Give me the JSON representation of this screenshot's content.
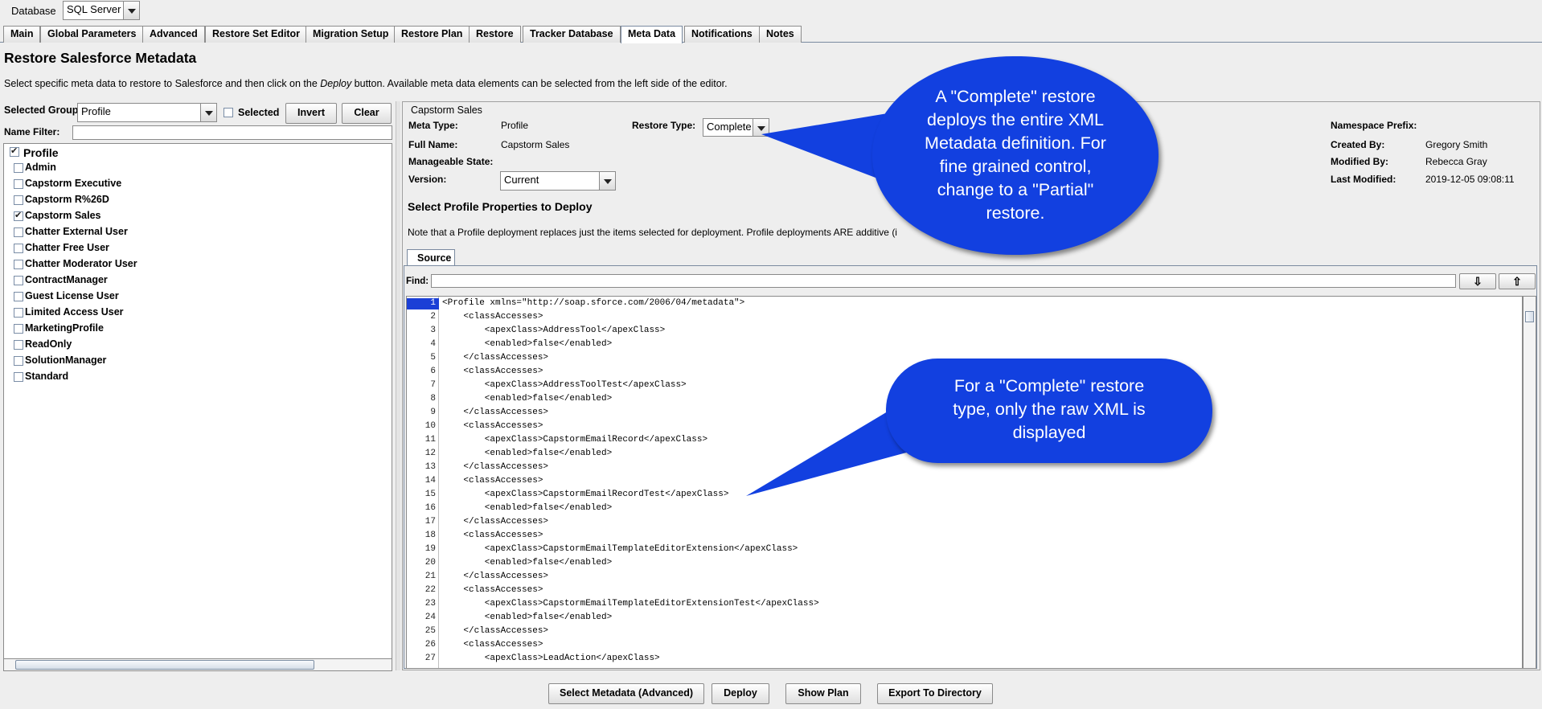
{
  "header": {
    "database_label": "Database",
    "database_value": "SQL Server"
  },
  "tabs": [
    {
      "label": "Main"
    },
    {
      "label": "Global Parameters"
    },
    {
      "label": "Advanced"
    },
    {
      "label": "Restore Set Editor"
    },
    {
      "label": "Migration Setup"
    },
    {
      "label": "Restore Plan"
    },
    {
      "label": "Restore"
    },
    {
      "label": "Tracker Database"
    },
    {
      "label": "Meta Data"
    },
    {
      "label": "Notifications"
    },
    {
      "label": "Notes"
    }
  ],
  "active_tab": "Meta Data",
  "page": {
    "title": "Restore Salesforce Metadata",
    "desc_before": "Select specific meta data to restore to Salesforce and then click on the ",
    "desc_italic": "Deploy",
    "desc_after": " button. Available meta data elements can be selected from the left side of the editor."
  },
  "left": {
    "group_label": "Selected Group",
    "group_value": "Profile",
    "selected_label": "Selected",
    "invert_label": "Invert",
    "clear_label": "Clear",
    "filter_label": "Name Filter:",
    "filter_value": "",
    "root": {
      "label": "Profile",
      "checked": true
    },
    "items": [
      {
        "label": "Admin",
        "checked": false
      },
      {
        "label": "Capstorm Executive",
        "checked": false
      },
      {
        "label": "Capstorm R%26D",
        "checked": false
      },
      {
        "label": "Capstorm Sales",
        "checked": true
      },
      {
        "label": "Chatter External User",
        "checked": false
      },
      {
        "label": "Chatter Free User",
        "checked": false
      },
      {
        "label": "Chatter Moderator User",
        "checked": false
      },
      {
        "label": "ContractManager",
        "checked": false
      },
      {
        "label": "Guest License User",
        "checked": false
      },
      {
        "label": "Limited Access User",
        "checked": false
      },
      {
        "label": "MarketingProfile",
        "checked": false
      },
      {
        "label": "ReadOnly",
        "checked": false
      },
      {
        "label": "SolutionManager",
        "checked": false
      },
      {
        "label": "Standard",
        "checked": false
      }
    ]
  },
  "detail": {
    "group_title": "Capstorm Sales",
    "meta_type_label": "Meta Type:",
    "meta_type_value": "Profile",
    "restore_type_label": "Restore Type:",
    "restore_type_value": "Complete",
    "full_name_label": "Full Name:",
    "full_name_value": "Capstorm Sales",
    "manageable_label": "Manageable State:",
    "version_label": "Version:",
    "version_value": "Current",
    "namespace_label": "Namespace Prefix:",
    "created_by_label": "Created By:",
    "created_by_value": "Gregory Smith",
    "modified_by_label": "Modified By:",
    "modified_by_value": "Rebecca Gray",
    "last_modified_label": "Last Modified:",
    "last_modified_value": "2019-12-05 09:08:11",
    "section_title": "Select Profile Properties to Deploy",
    "note": "Note that a Profile deployment replaces just the items selected for deployment. Profile deployments ARE additive (i",
    "source_tab": "Source",
    "find_label": "Find:",
    "find_value": ""
  },
  "code_lines": [
    "<Profile xmlns=\"http://soap.sforce.com/2006/04/metadata\">",
    "    <classAccesses>",
    "        <apexClass>AddressTool</apexClass>",
    "        <enabled>false</enabled>",
    "    </classAccesses>",
    "    <classAccesses>",
    "        <apexClass>AddressToolTest</apexClass>",
    "        <enabled>false</enabled>",
    "    </classAccesses>",
    "    <classAccesses>",
    "        <apexClass>CapstormEmailRecord</apexClass>",
    "        <enabled>false</enabled>",
    "    </classAccesses>",
    "    <classAccesses>",
    "        <apexClass>CapstormEmailRecordTest</apexClass>",
    "        <enabled>false</enabled>",
    "    </classAccesses>",
    "    <classAccesses>",
    "        <apexClass>CapstormEmailTemplateEditorExtension</apexClass>",
    "        <enabled>false</enabled>",
    "    </classAccesses>",
    "    <classAccesses>",
    "        <apexClass>CapstormEmailTemplateEditorExtensionTest</apexClass>",
    "        <enabled>false</enabled>",
    "    </classAccesses>",
    "    <classAccesses>",
    "        <apexClass>LeadAction</apexClass>"
  ],
  "line_numbers": [
    "1",
    "2",
    "3",
    "4",
    "5",
    "6",
    "7",
    "8",
    "9",
    "10",
    "11",
    "12",
    "13",
    "14",
    "15",
    "16",
    "17",
    "18",
    "19",
    "20",
    "21",
    "22",
    "23",
    "24",
    "25",
    "26",
    "27"
  ],
  "callouts": {
    "complete_lines": [
      "A \"Complete\" restore",
      "deploys the entire XML",
      "Metadata definition. For",
      "fine grained control,",
      "change to a \"Partial\"",
      "restore."
    ],
    "raw_lines": [
      "For a \"Complete\" restore",
      "type, only the raw XML is",
      "displayed"
    ]
  },
  "footer": {
    "select_metadata": "Select Metadata (Advanced)",
    "deploy": "Deploy",
    "show_plan": "Show Plan",
    "export": "Export To Directory"
  },
  "colors": {
    "callout": "#1240e0",
    "line_highlight": "#1b3fd6"
  }
}
